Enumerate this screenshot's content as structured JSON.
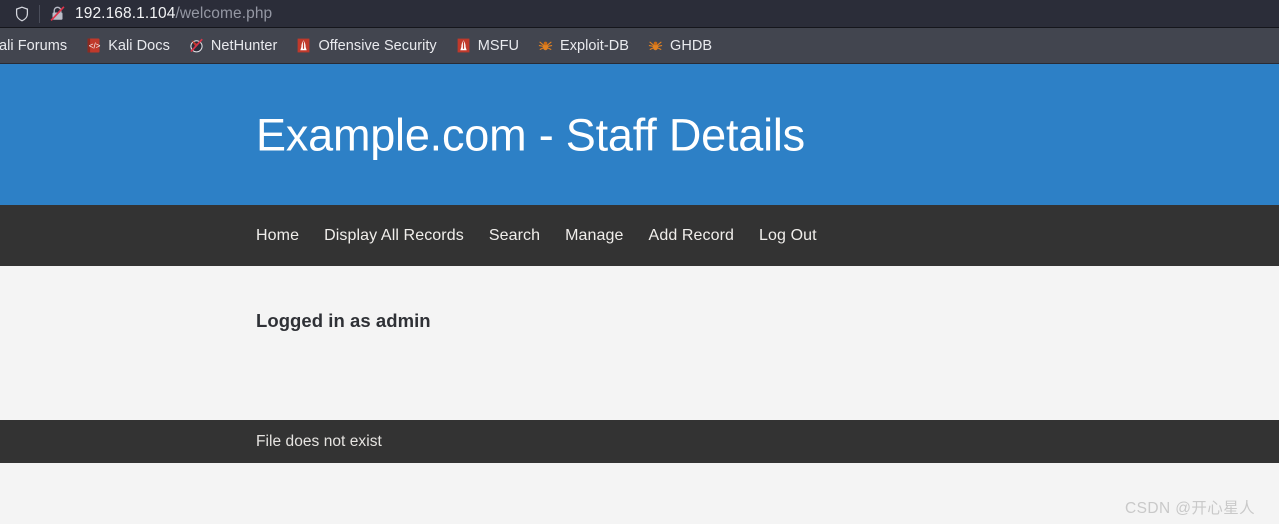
{
  "browser": {
    "shield_icon": "shield-icon",
    "security_icon": "broken-lock-icon",
    "url_host": "192.168.1.104",
    "url_path": "/welcome.php",
    "bookmarks": [
      {
        "label": "ali Forums",
        "icon": "kali-forums-icon"
      },
      {
        "label": "Kali Docs",
        "icon": "kali-docs-book-icon"
      },
      {
        "label": "NetHunter",
        "icon": "nethunter-icon"
      },
      {
        "label": "Offensive Security",
        "icon": "offensive-security-icon"
      },
      {
        "label": "MSFU",
        "icon": "msfu-icon"
      },
      {
        "label": "Exploit-DB",
        "icon": "exploit-db-spider-icon"
      },
      {
        "label": "GHDB",
        "icon": "ghdb-spider-icon"
      }
    ]
  },
  "page": {
    "title": "Example.com - Staff Details",
    "nav": [
      {
        "label": "Home"
      },
      {
        "label": "Display All Records"
      },
      {
        "label": "Search"
      },
      {
        "label": "Manage"
      },
      {
        "label": "Add Record"
      },
      {
        "label": "Log Out"
      }
    ],
    "body": {
      "logged_in_text": "Logged in as admin"
    },
    "footer": {
      "message": "File does not exist"
    }
  },
  "watermark": {
    "text": "CSDN @开心星人"
  },
  "colors": {
    "header_blue": "#2d80c6",
    "nav_dark": "#333333",
    "body_light": "#f4f4f4",
    "urlbar_dark": "#2b2d39",
    "bookmarkbar_dark": "#42454f",
    "accent_red": "#c0392b",
    "accent_orange": "#e08020"
  }
}
